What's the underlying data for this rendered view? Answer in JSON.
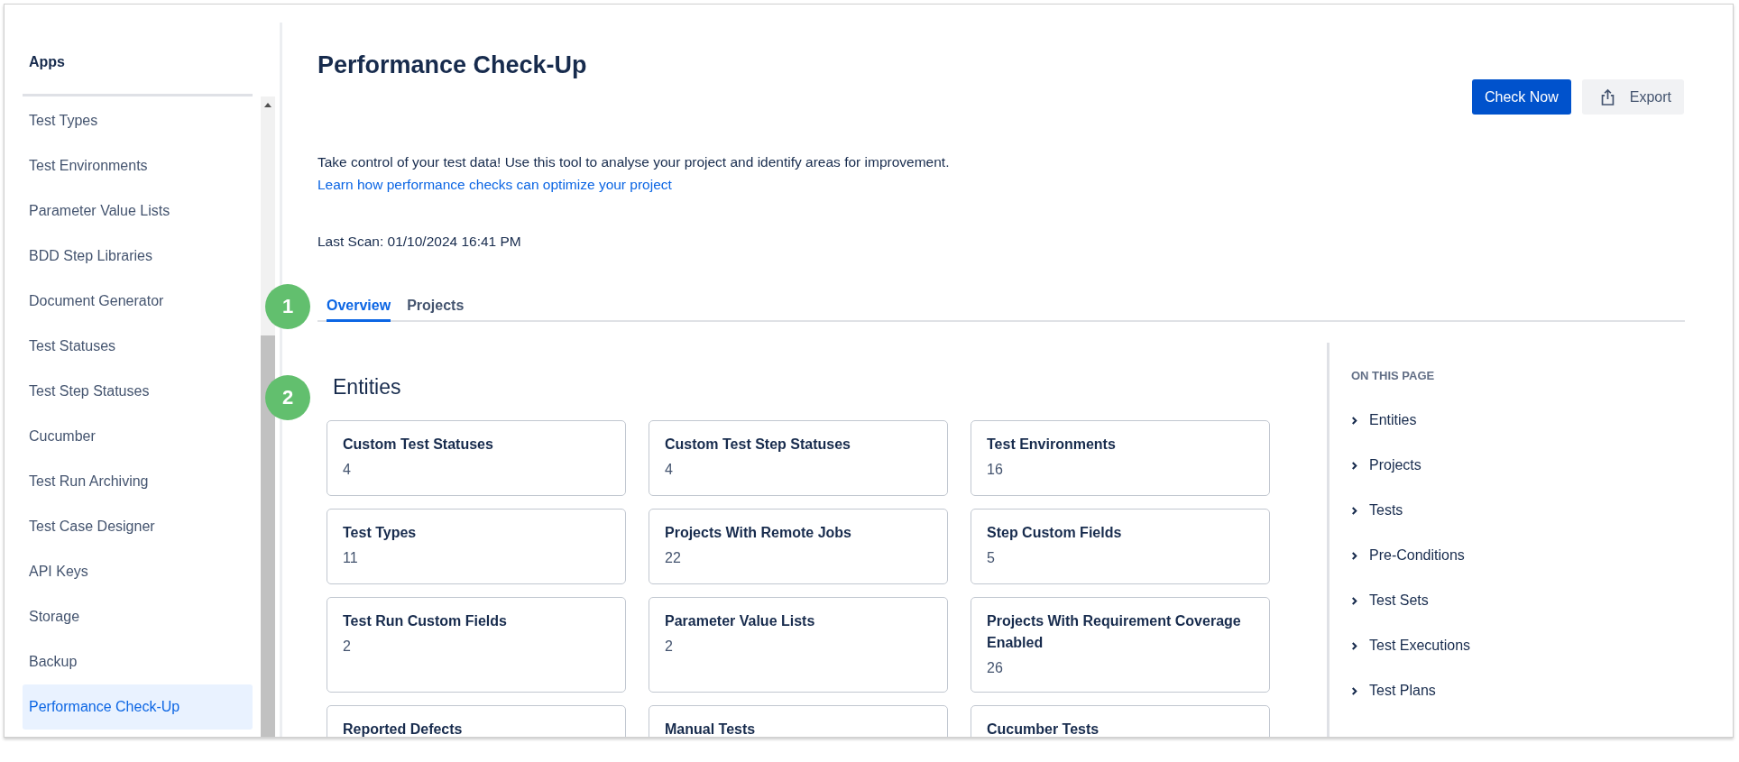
{
  "sidebar": {
    "heading": "Apps",
    "items": [
      {
        "label": "Test Types",
        "selected": false
      },
      {
        "label": "Test Environments",
        "selected": false
      },
      {
        "label": "Parameter Value Lists",
        "selected": false
      },
      {
        "label": "BDD Step Libraries",
        "selected": false
      },
      {
        "label": "Document Generator",
        "selected": false
      },
      {
        "label": "Test Statuses",
        "selected": false
      },
      {
        "label": "Test Step Statuses",
        "selected": false
      },
      {
        "label": "Cucumber",
        "selected": false
      },
      {
        "label": "Test Run Archiving",
        "selected": false
      },
      {
        "label": "Test Case Designer",
        "selected": false
      },
      {
        "label": "API Keys",
        "selected": false
      },
      {
        "label": "Storage",
        "selected": false
      },
      {
        "label": "Backup",
        "selected": false
      },
      {
        "label": "Performance Check-Up",
        "selected": true
      }
    ]
  },
  "page": {
    "title": "Performance Check-Up",
    "buttons": [
      {
        "label": "Check Now",
        "kind": "primary"
      },
      {
        "label": "Export",
        "kind": "secondary"
      }
    ],
    "description": "Take control of your test data! Use this tool to analyse your project and identify areas for improvement.",
    "link": "Learn how performance checks can optimize your project",
    "last_scan": "Last Scan: 01/10/2024 16:41 PM",
    "tabs": [
      {
        "label": "Overview",
        "selected": true
      },
      {
        "label": "Projects",
        "selected": false
      }
    ]
  },
  "annotations": [
    "1",
    "2"
  ],
  "section": {
    "title": "Entities",
    "cards": [
      {
        "title": "Custom Test Statuses",
        "value": "4"
      },
      {
        "title": "Custom Test Step Statuses",
        "value": "4"
      },
      {
        "title": "Test Environments",
        "value": "16"
      },
      {
        "title": "Test Types",
        "value": "11"
      },
      {
        "title": "Projects With Remote Jobs",
        "value": "22"
      },
      {
        "title": "Step Custom Fields",
        "value": "5"
      },
      {
        "title": "Test Run Custom Fields",
        "value": "2"
      },
      {
        "title": "Parameter Value Lists",
        "value": "2"
      },
      {
        "title": "Projects With Requirement Coverage Enabled",
        "value": "26"
      },
      {
        "title": "Reported Defects"
      },
      {
        "title": "Manual Tests"
      },
      {
        "title": "Cucumber Tests"
      }
    ]
  },
  "toc": {
    "heading": "ON THIS PAGE",
    "items": [
      "Entities",
      "Projects",
      "Tests",
      "Pre-Conditions",
      "Test Sets",
      "Test Executions",
      "Test Plans"
    ]
  }
}
